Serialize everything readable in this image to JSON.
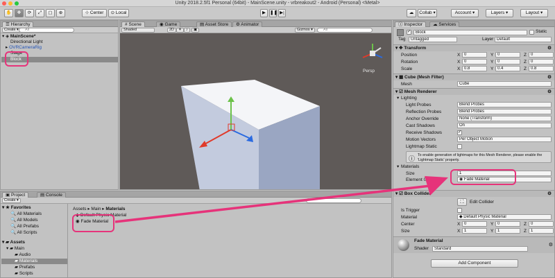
{
  "window": {
    "title": "Unity 2018.2.5f1 Personal (64bit) - MainScene.unity - vrbreakout2 - Android (Personal) <Metal>"
  },
  "toolbar": {
    "pivot_label": "Center",
    "space_label": "Local",
    "collab_label": "Collab ▾",
    "account_label": "Account ▾",
    "layers_label": "Layers ▾",
    "layout_label": "Layout ▾"
  },
  "hierarchy": {
    "tab": "Hierarchy",
    "create": "Create ▾",
    "search_placeholder": "All",
    "scene": "MainScene*",
    "items": [
      "Directional Light",
      "OVRCameraRig",
      "Stage",
      "Block"
    ]
  },
  "scene": {
    "tabs": [
      "Scene",
      "Game",
      "Asset Store",
      "Animator"
    ],
    "shading": "Shaded",
    "mode_2d": "2D",
    "gizmos": "Gizmos ▾",
    "search_placeholder": "All",
    "persp": "Persp"
  },
  "project": {
    "tabs": [
      "Project",
      "Console"
    ],
    "create": "Create ▾",
    "favorites_title": "Favorites",
    "favorites": [
      "All Materials",
      "All Models",
      "All Prefabs",
      "All Scripts"
    ],
    "assets_title": "Assets",
    "assets": [
      "Main",
      "Audio",
      "Materials",
      "Prefabs",
      "Scripts"
    ],
    "breadcrumb": [
      "Assets",
      "Main",
      "Materials"
    ],
    "files": [
      "Default Physic Material",
      "Fade Material"
    ]
  },
  "inspector": {
    "tabs": [
      "Inspector",
      "Services"
    ],
    "object_name": "Block",
    "static_label": "Static",
    "tag_label": "Tag",
    "tag_value": "Untagged",
    "layer_label": "Layer",
    "layer_value": "Default",
    "transform": {
      "title": "Transform",
      "rows": [
        {
          "label": "Position",
          "x": "0",
          "y": "0",
          "z": "0"
        },
        {
          "label": "Rotation",
          "x": "0",
          "y": "0",
          "z": "0"
        },
        {
          "label": "Scale",
          "x": "0.8",
          "y": "0.4",
          "z": "0.8"
        }
      ]
    },
    "mesh_filter": {
      "title": "Cube (Mesh Filter)",
      "label": "Mesh",
      "value": "Cube"
    },
    "mesh_renderer": {
      "title": "Mesh Renderer",
      "lighting": "Lighting",
      "light_probes_label": "Light Probes",
      "light_probes_value": "Blend Probes",
      "reflection_probes_label": "Reflection Probes",
      "reflection_probes_value": "Blend Probes",
      "anchor_override_label": "Anchor Override",
      "anchor_override_value": "None (Transform)",
      "cast_shadows_label": "Cast Shadows",
      "cast_shadows_value": "On",
      "receive_shadows_label": "Receive Shadows",
      "motion_vectors_label": "Motion Vectors",
      "motion_vectors_value": "Per Object Motion",
      "lightmap_static_label": "Lightmap Static",
      "info": "To enable generation of lightmaps for this Mesh Renderer, please enable the 'Lightmap Static' property.",
      "materials": "Materials",
      "size_label": "Size",
      "size_value": "1",
      "element0_label": "Element 0",
      "element0_value": "Fade Material"
    },
    "box_collider": {
      "title": "Box Collider",
      "edit_collider": "Edit Collider",
      "is_trigger": "Is Trigger",
      "material_label": "Material",
      "material_value": "Default Physic Material",
      "center_label": "Center",
      "center": {
        "x": "0",
        "y": "0",
        "z": "0"
      },
      "size_label": "Size",
      "size": {
        "x": "1",
        "y": "1",
        "z": "1"
      }
    },
    "material_preview": {
      "name": "Fade Material",
      "shader_label": "Shader",
      "shader_value": "Standard"
    },
    "add_component": "Add Component"
  },
  "colors": {
    "highlight": "#e6337a",
    "transform_x": "#e03a2a",
    "transform_y": "#6cc24a",
    "transform_z": "#2a6ae0"
  }
}
